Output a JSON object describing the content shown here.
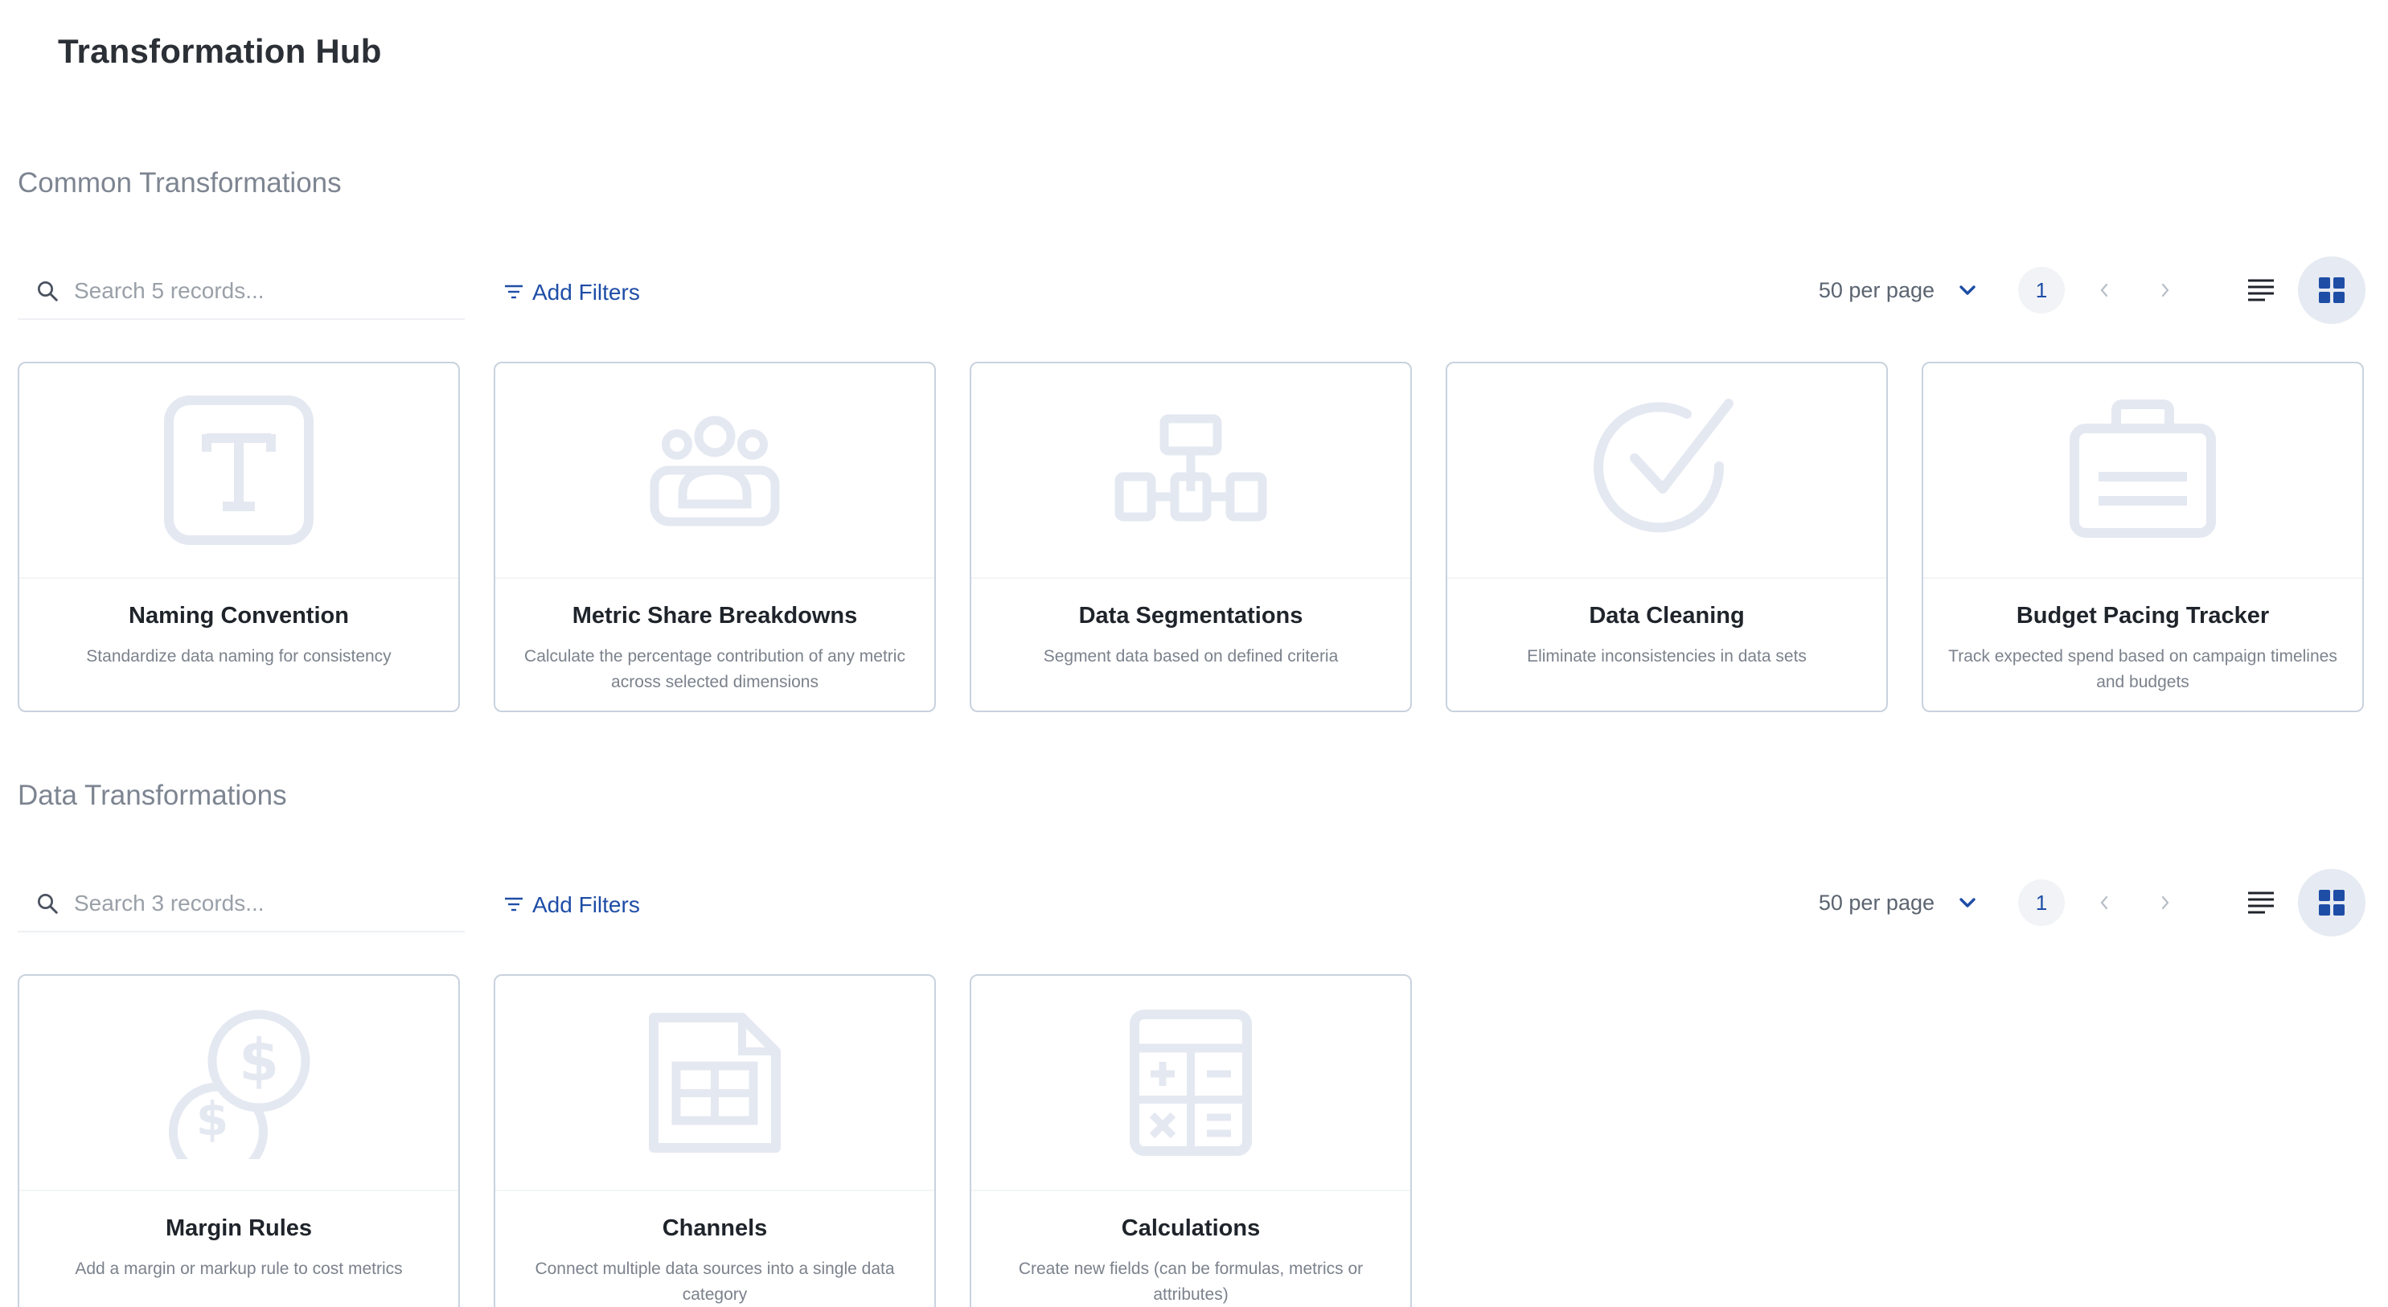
{
  "page": {
    "title": "Transformation Hub"
  },
  "colors": {
    "accent": "#1e4da6",
    "icon_muted": "#e4e8f1",
    "card_border": "#c9d2de",
    "heading_muted": "#7d8591"
  },
  "sections": [
    {
      "heading": "Common Transformations",
      "search_placeholder": "Search 5 records...",
      "add_filters_label": "Add Filters",
      "per_page_label": "50 per page",
      "current_page": "1",
      "cards": [
        {
          "title": "Naming Convention",
          "description": "Standardize data naming for consistency",
          "icon": "text-format-icon"
        },
        {
          "title": "Metric Share Breakdowns",
          "description": "Calculate the percentage contribution of any metric across selected dimensions",
          "icon": "group-icon"
        },
        {
          "title": "Data Segmentations",
          "description": "Segment data based on defined criteria",
          "icon": "hierarchy-icon"
        },
        {
          "title": "Data Cleaning",
          "description": "Eliminate inconsistencies in data sets",
          "icon": "check-circle-icon"
        },
        {
          "title": "Budget Pacing Tracker",
          "description": "Track expected spend based on campaign timelines and budgets",
          "icon": "briefcase-icon"
        }
      ]
    },
    {
      "heading": "Data Transformations",
      "search_placeholder": "Search 3 records...",
      "add_filters_label": "Add Filters",
      "per_page_label": "50 per page",
      "current_page": "1",
      "cards": [
        {
          "title": "Margin Rules",
          "description": "Add a margin or markup rule to cost metrics",
          "icon": "coins-icon"
        },
        {
          "title": "Channels",
          "description": "Connect multiple data sources into a single data category",
          "icon": "spreadsheet-file-icon"
        },
        {
          "title": "Calculations",
          "description": "Create new fields (can be formulas, metrics or attributes)",
          "icon": "calculator-icon"
        }
      ]
    }
  ]
}
